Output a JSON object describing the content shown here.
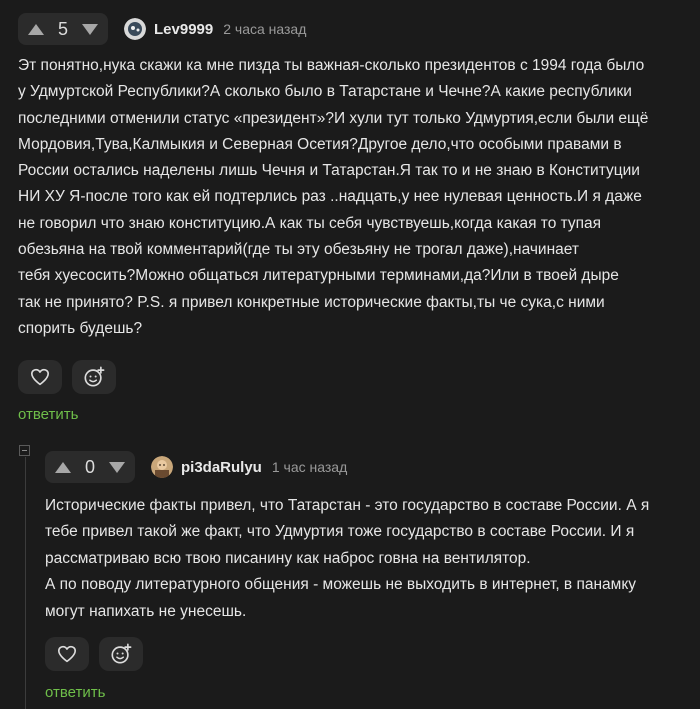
{
  "comments": [
    {
      "score": "5",
      "username": "Lev9999",
      "time": "2 часа назад",
      "text": "Эт понятно,нука скажи ка мне пизда ты важная-сколько президентов с 1994 года было\nу Удмуртской Республики?А сколько было в Татарстане и Чечне?А какие республики\nпоследними отменили статус «президент»?И хули тут только Удмуртия,если были ещё\nМордовия,Тува,Калмыкия и Северная Осетия?Другое дело,что особыми правами в\nРоссии остались наделены лишь Чечня и Татарстан.Я так то и не знаю в Конституции\nНИ ХУ Я-после того как ей подтерлись раз ..надцать,у нее нулевая ценность.И я даже\nне говорил что знаю конституцию.А как ты себя чувствуешь,когда какая то тупая\nобезьяна на твой комментарий(где ты эту обезьяну не трогал даже),начинает\nтебя хуесосить?Можно общаться литературными терминами,да?Или в твоей дыре\nтак не принято? P.S. я привел конкретные исторические факты,ты че сука,с ними\nспорить будешь?",
      "reply_label": "ответить"
    },
    {
      "score": "0",
      "username": "pi3daRulyu",
      "time": "1 час назад",
      "text": "Исторические факты привел, что Татарстан - это государство в составе России. А я\nтебе привел такой же факт, что Удмуртия тоже государство в составе России. И я\nрассматриваю всю твою писанину как наброс говна на вентилятор.\nА по поводу литературного общения - можешь не выходить в интернет, в панамку\nмогут напихать не унесешь.",
      "reply_label": "ответить"
    }
  ],
  "icons": {
    "upvote": "triangle-up-icon",
    "downvote": "triangle-down-icon",
    "like": "heart-icon",
    "reaction": "emoji-plus-icon",
    "collapse": "minus-square-icon"
  },
  "colors": {
    "background": "#1b1b1b",
    "button_bg": "#2b2b2b",
    "reply": "#6fbf4a",
    "text": "#e6e6e6",
    "muted": "#9a9a9a"
  }
}
